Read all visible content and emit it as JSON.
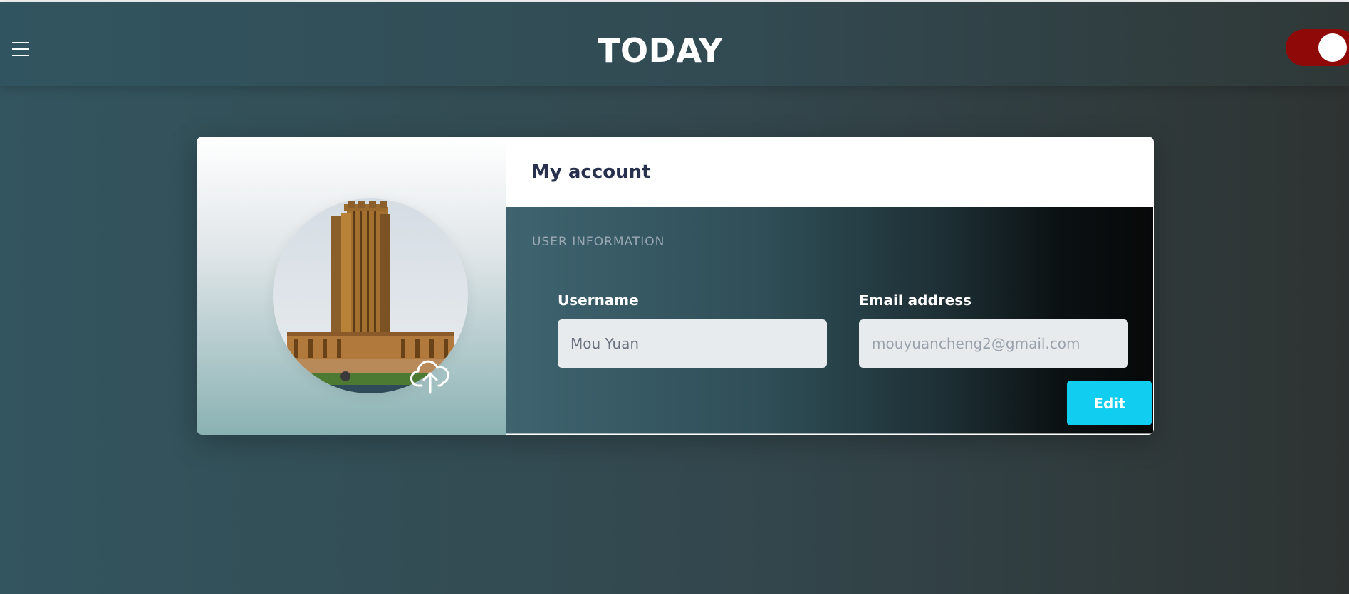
{
  "header": {
    "title": "TODAY",
    "menu_icon": "hamburger-menu-icon",
    "theme_toggle": {
      "state": "on",
      "color": "#8f0909"
    }
  },
  "profile": {
    "avatar_alt": "Profile photo of a tall brown tower",
    "upload_icon": "cloud-upload-icon"
  },
  "account": {
    "title": "My account",
    "section_label": "USER INFORMATION",
    "username": {
      "label": "Username",
      "value": "Mou Yuan",
      "placeholder": ""
    },
    "email": {
      "label": "Email address",
      "value": "",
      "placeholder": "mouyuancheng2@gmail.com"
    },
    "edit_label": "Edit"
  },
  "colors": {
    "accent": "#11cdef",
    "title_text": "#27304d",
    "toggle": "#8f0909"
  }
}
